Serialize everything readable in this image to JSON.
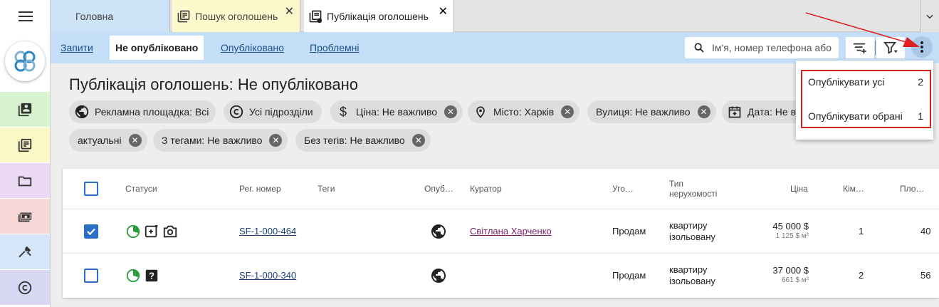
{
  "tabs": [
    {
      "label": "Головна",
      "icon": "home-tab",
      "color": "#cfe3f8"
    },
    {
      "label": "Пошук оголошень",
      "icon": "listing-icon",
      "color": "#fdf9cc"
    },
    {
      "label": "Публікація оголошень",
      "icon": "publish-icon",
      "color": "#ffffff"
    }
  ],
  "subnav": {
    "links": [
      "Запити",
      "Не опубліковано",
      "Опубліковано",
      "Проблемні"
    ],
    "active": "Не опубліковано",
    "search_placeholder": "Ім'я, номер телефона або"
  },
  "page": {
    "title": "Публікація оголошень: Не опубліковано"
  },
  "chips": [
    {
      "label": "Рекламна площадка: Всі",
      "icon": "globe-icon",
      "removable": false
    },
    {
      "label": "Усі підрозділи",
      "icon": "copyright-icon",
      "removable": false
    },
    {
      "label": "Ціна: Не важливо",
      "icon": "dollar-icon",
      "removable": true
    },
    {
      "label": "Місто: Харків",
      "icon": "location-icon",
      "removable": true
    },
    {
      "label": "Вулиця: Не важливо",
      "icon": "",
      "removable": true
    },
    {
      "label": "Дата: Не в",
      "icon": "calendar-add-icon",
      "removable": false
    },
    {
      "label": "актуальні",
      "icon": "",
      "removable": true
    },
    {
      "label": "З тегами: Не важливо",
      "icon": "",
      "removable": true
    },
    {
      "label": "Без тегів: Не важливо",
      "icon": "",
      "removable": true
    }
  ],
  "table": {
    "headers": {
      "statuses": "Статуси",
      "reg": "Рег. номер",
      "tags": "Теги",
      "published": "Опуб…",
      "curator": "Куратор",
      "deal": "Уго…",
      "type_line1": "Тип",
      "type_line2": "нерухомості",
      "price": "Ціна",
      "rooms": "Кім…",
      "area": "Пло…"
    },
    "rows": [
      {
        "selected": true,
        "status_icons": [
          "pie-status-icon",
          "add-photo-icon",
          "camera-icon"
        ],
        "reg": "SF-1-000-464",
        "curator": "Світлана Харченко",
        "deal": "Продам",
        "type_line1": "квартиру",
        "type_line2": "ізольовану",
        "price": "45 000 $",
        "price_per_m2": "1 125 $ м²",
        "rooms": "1",
        "area": "40"
      },
      {
        "selected": false,
        "status_icons": [
          "pie-status-icon",
          "question-icon"
        ],
        "reg": "SF-1-000-340",
        "curator": "",
        "deal": "Продам",
        "type_line1": "квартиру",
        "type_line2": "ізольовану",
        "price": "37 000 $",
        "price_per_m2": "661 $ м²",
        "rooms": "2",
        "area": "56"
      }
    ]
  },
  "menu": {
    "items": [
      {
        "label": "Опублікувати усі",
        "count": "2"
      },
      {
        "label": "Опублікувати обрані",
        "count": "1"
      }
    ]
  },
  "colors": {
    "accent": "#2c6fc9",
    "subnav_bg": "#c5def7",
    "annotation_red": "#d32020"
  }
}
